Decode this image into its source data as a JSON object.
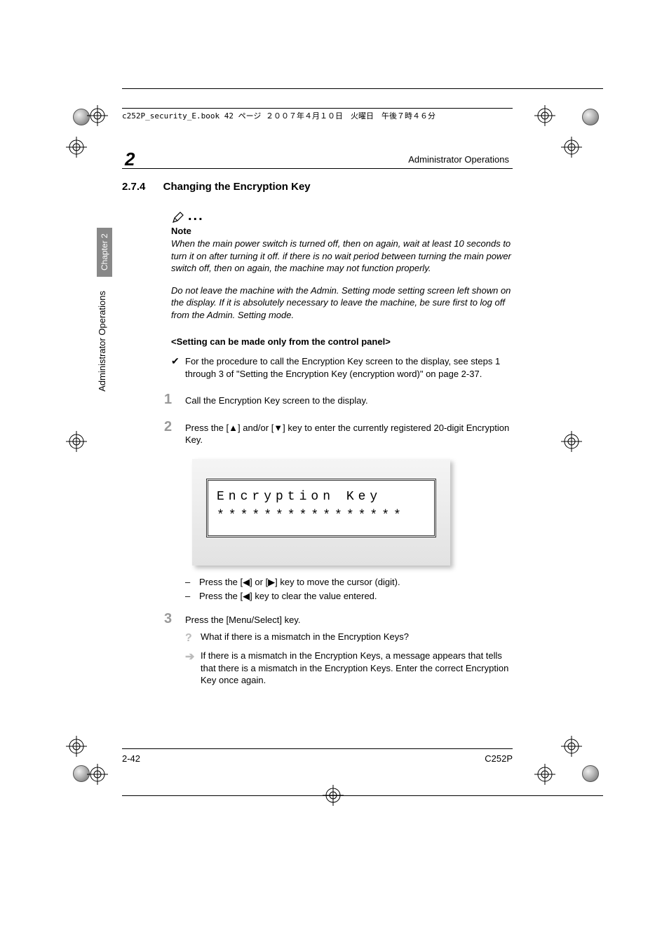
{
  "header_line": "c252P_security_E.book  42 ページ  ２００７年４月１０日　火曜日　午後７時４６分",
  "chapter_number": "2",
  "top_right_title": "Administrator Operations",
  "section": {
    "number": "2.7.4",
    "title": "Changing the Encryption Key"
  },
  "note": {
    "label": "Note",
    "para1": "When the main power switch is turned off, then on again, wait at least 10 seconds to turn it on after turning it off. if there is no wait period between turning the main power switch off, then on again, the machine may not function properly.",
    "para2": "Do not leave the machine with the Admin. Setting mode setting screen left shown on the display. If it is absolutely necessary to leave the machine, be sure first to log off from the Admin. Setting mode."
  },
  "setting_header": "<Setting can be made only from the control panel>",
  "check_item": "For the procedure to call the Encryption Key screen to the display, see steps 1 through 3 of \"Setting the Encryption Key (encryption word)\" on page 2-37.",
  "steps": {
    "s1": "Call the Encryption Key screen to the display.",
    "s2": "Press the [▲] and/or [▼] key to enter the currently registered 20-digit Encryption Key.",
    "s2_dash1": "Press the [◀] or [▶] key to move the cursor (digit).",
    "s2_dash2": "Press the [◀] key to clear the value entered.",
    "s3": "Press the [Menu/Select] key.",
    "s3_q": "What if there is a mismatch in the Encryption Keys?",
    "s3_a": "If there is a mismatch in the Encryption Keys, a message appears that tells that there is a mismatch in the Encryption Keys. Enter the correct Encryption Key once again."
  },
  "lcd": {
    "line1": "Encryption Key",
    "line2": "****************"
  },
  "side_tab": "Chapter 2",
  "side_label": "Administrator Operations",
  "footer": {
    "left": "2-42",
    "right": "C252P"
  }
}
